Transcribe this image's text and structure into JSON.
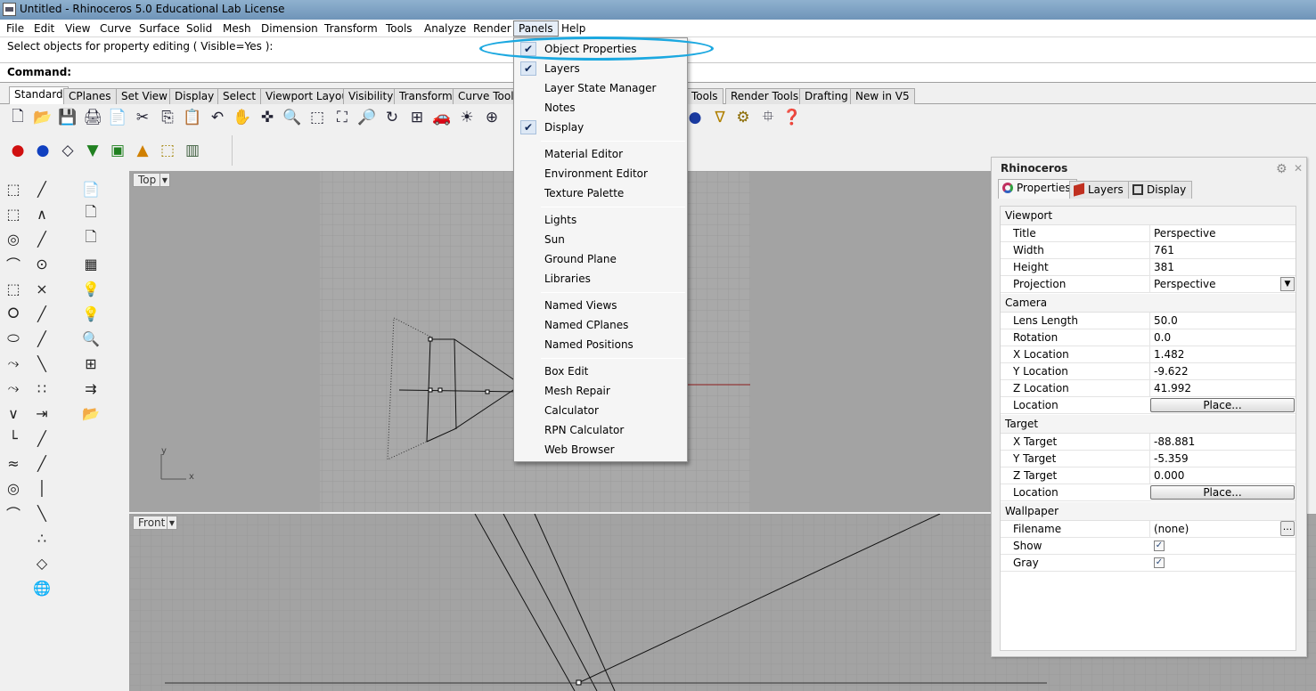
{
  "window": {
    "title": "Untitled - Rhinoceros 5.0 Educational Lab License"
  },
  "menubar": {
    "items": [
      "File",
      "Edit",
      "View",
      "Curve",
      "Surface",
      "Solid",
      "Mesh",
      "Dimension",
      "Transform",
      "Tools",
      "Analyze",
      "Render",
      "Panels",
      "Help"
    ],
    "active": "Panels"
  },
  "prompt": {
    "text": "Select objects for property editing ( Visible=Yes ):"
  },
  "command": {
    "label": "Command:",
    "value": ""
  },
  "toolbar_tabs": {
    "items": [
      "Standard",
      "CPlanes",
      "Set View",
      "Display",
      "Select",
      "Viewport Layout",
      "Visibility",
      "Transform",
      "Curve Tools",
      "Tools",
      "Render Tools",
      "Drafting",
      "New in V5"
    ],
    "selected": "Standard"
  },
  "toolbar_icons": [
    "new-icon",
    "open-icon",
    "save-icon",
    "print-icon",
    "import-icon",
    "cut-icon",
    "copy-icon",
    "paste-icon",
    "undo-icon",
    "pan-icon",
    "rotate-view-icon",
    "zoom-icon",
    "zoom-window-icon",
    "zoom-extents-icon",
    "zoom-selected-icon",
    "rotate-icon",
    "four-viewports-icon",
    "car-icon",
    "lights-icon",
    "target-icon"
  ],
  "toolbar_icons_right": [
    "sphere-icon",
    "spotlight-icon",
    "settings-gear-icon",
    "join-icon",
    "help-icon"
  ],
  "toolbar2_icons": [
    "red-sphere-icon",
    "blue-sphere-icon",
    "wireframe-icon",
    "shaded-icon",
    "render-icon",
    "cone-icon",
    "bbox-icon",
    "object-icon"
  ],
  "viewports": {
    "top_label": "Top",
    "front_label": "Front",
    "axis_x": "x",
    "axis_y": "y"
  },
  "panels_menu": {
    "items": [
      {
        "label": "Object Properties",
        "checked": true
      },
      {
        "label": "Layers",
        "checked": true
      },
      {
        "label": "Layer State Manager",
        "checked": false
      },
      {
        "label": "Notes",
        "checked": false
      },
      {
        "label": "Display",
        "checked": true
      },
      {
        "label": "Material Editor",
        "checked": false
      },
      {
        "label": "Environment Editor",
        "checked": false
      },
      {
        "label": "Texture Palette",
        "checked": false
      },
      {
        "label": "Lights",
        "checked": false
      },
      {
        "label": "Sun",
        "checked": false
      },
      {
        "label": "Ground Plane",
        "checked": false
      },
      {
        "label": "Libraries",
        "checked": false
      },
      {
        "label": "Named Views",
        "checked": false
      },
      {
        "label": "Named CPlanes",
        "checked": false
      },
      {
        "label": "Named Positions",
        "checked": false
      },
      {
        "label": "Box Edit",
        "checked": false
      },
      {
        "label": "Mesh Repair",
        "checked": false
      },
      {
        "label": "Calculator",
        "checked": false
      },
      {
        "label": "RPN Calculator",
        "checked": false
      },
      {
        "label": "Web Browser",
        "checked": false
      }
    ],
    "highlight_color": "#1ba8e0"
  },
  "panel": {
    "title": "Rhinoceros",
    "tabs": [
      "Properties",
      "Layers",
      "Display"
    ],
    "selected_tab": "Properties",
    "viewport": {
      "group": "Viewport",
      "title_label": "Title",
      "title_value": "Perspective",
      "width_label": "Width",
      "width_value": "761",
      "height_label": "Height",
      "height_value": "381",
      "projection_label": "Projection",
      "projection_value": "Perspective"
    },
    "camera": {
      "group": "Camera",
      "lens_label": "Lens Length",
      "lens_value": "50.0",
      "rotation_label": "Rotation",
      "rotation_value": "0.0",
      "x_label": "X Location",
      "x_value": "1.482",
      "y_label": "Y Location",
      "y_value": "-9.622",
      "z_label": "Z Location",
      "z_value": "41.992",
      "location_label": "Location",
      "place_button": "Place..."
    },
    "target": {
      "group": "Target",
      "x_label": "X Target",
      "x_value": "-88.881",
      "y_label": "Y Target",
      "y_value": "-5.359",
      "z_label": "Z Target",
      "z_value": "0.000",
      "location_label": "Location",
      "place_button": "Place..."
    },
    "wallpaper": {
      "group": "Wallpaper",
      "filename_label": "Filename",
      "filename_value": "(none)",
      "browse_button": "...",
      "show_label": "Show",
      "show_checked": true,
      "gray_label": "Gray",
      "gray_checked": true
    }
  }
}
